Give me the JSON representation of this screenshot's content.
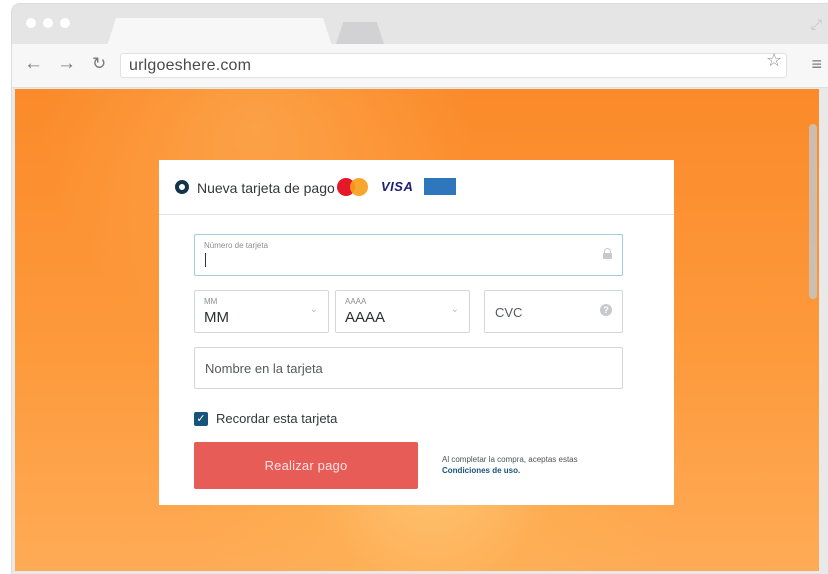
{
  "browser": {
    "url": "urlgoeshere.com"
  },
  "payment": {
    "option_label": "Nueva tarjeta de pago",
    "card_brands": {
      "visa": "VISA"
    },
    "card_number": {
      "label": "Número de tarjeta",
      "value": ""
    },
    "expiry_month": {
      "label": "MM",
      "value": "MM"
    },
    "expiry_year": {
      "label": "AAAA",
      "value": "AAAA"
    },
    "cvc": {
      "placeholder": "CVC"
    },
    "name_on_card": {
      "placeholder": "Nombre en la tarjeta"
    },
    "remember": {
      "label": "Recordar esta tarjeta",
      "checked": true
    },
    "submit_label": "Realizar pago",
    "terms_text": "Al completar la compra, aceptas estas",
    "terms_link": "Condiciones de uso."
  },
  "colors": {
    "background_orange": "#fb8a2a",
    "button_red": "#e85c58",
    "accent_navy": "#17547a"
  },
  "icons": [
    "back-arrow-icon",
    "forward-arrow-icon",
    "reload-icon",
    "star-icon",
    "menu-icon",
    "lock-icon",
    "chevron-down-icon",
    "help-icon",
    "check-icon",
    "mastercard-logo",
    "amex-logo"
  ]
}
